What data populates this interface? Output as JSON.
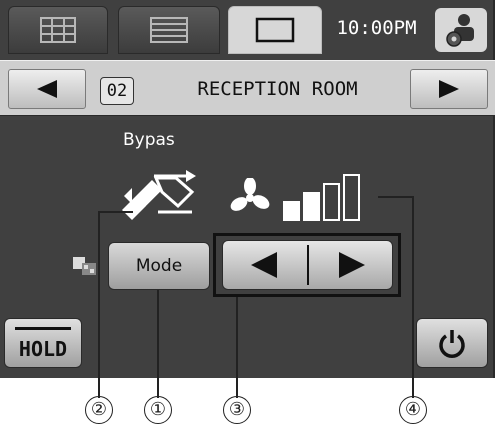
{
  "tabs": [
    {
      "icon": "grid-icon"
    },
    {
      "icon": "list-icon"
    },
    {
      "icon": "single-room-icon",
      "active": true
    }
  ],
  "clock": "10:00PM",
  "settings_icon": "settings-person-icon",
  "room": {
    "number": "02",
    "name": "RECEPTION ROOM"
  },
  "bypass": {
    "label": "Bypas",
    "icon": "bypass-icon"
  },
  "fan": {
    "icon": "fan-icon",
    "speed_level": 2,
    "speed_max": 4
  },
  "mode": {
    "label": "Mode",
    "icon": "mode-small-icon"
  },
  "hold": {
    "label": "HOLD"
  },
  "power": {
    "icon": "power-icon"
  },
  "callouts": [
    "②",
    "①",
    "③",
    "④"
  ],
  "colors": {
    "screen_bg": "#404040",
    "nav_bg": "#cfcfcf",
    "tab_active": "#d7d7d7"
  }
}
